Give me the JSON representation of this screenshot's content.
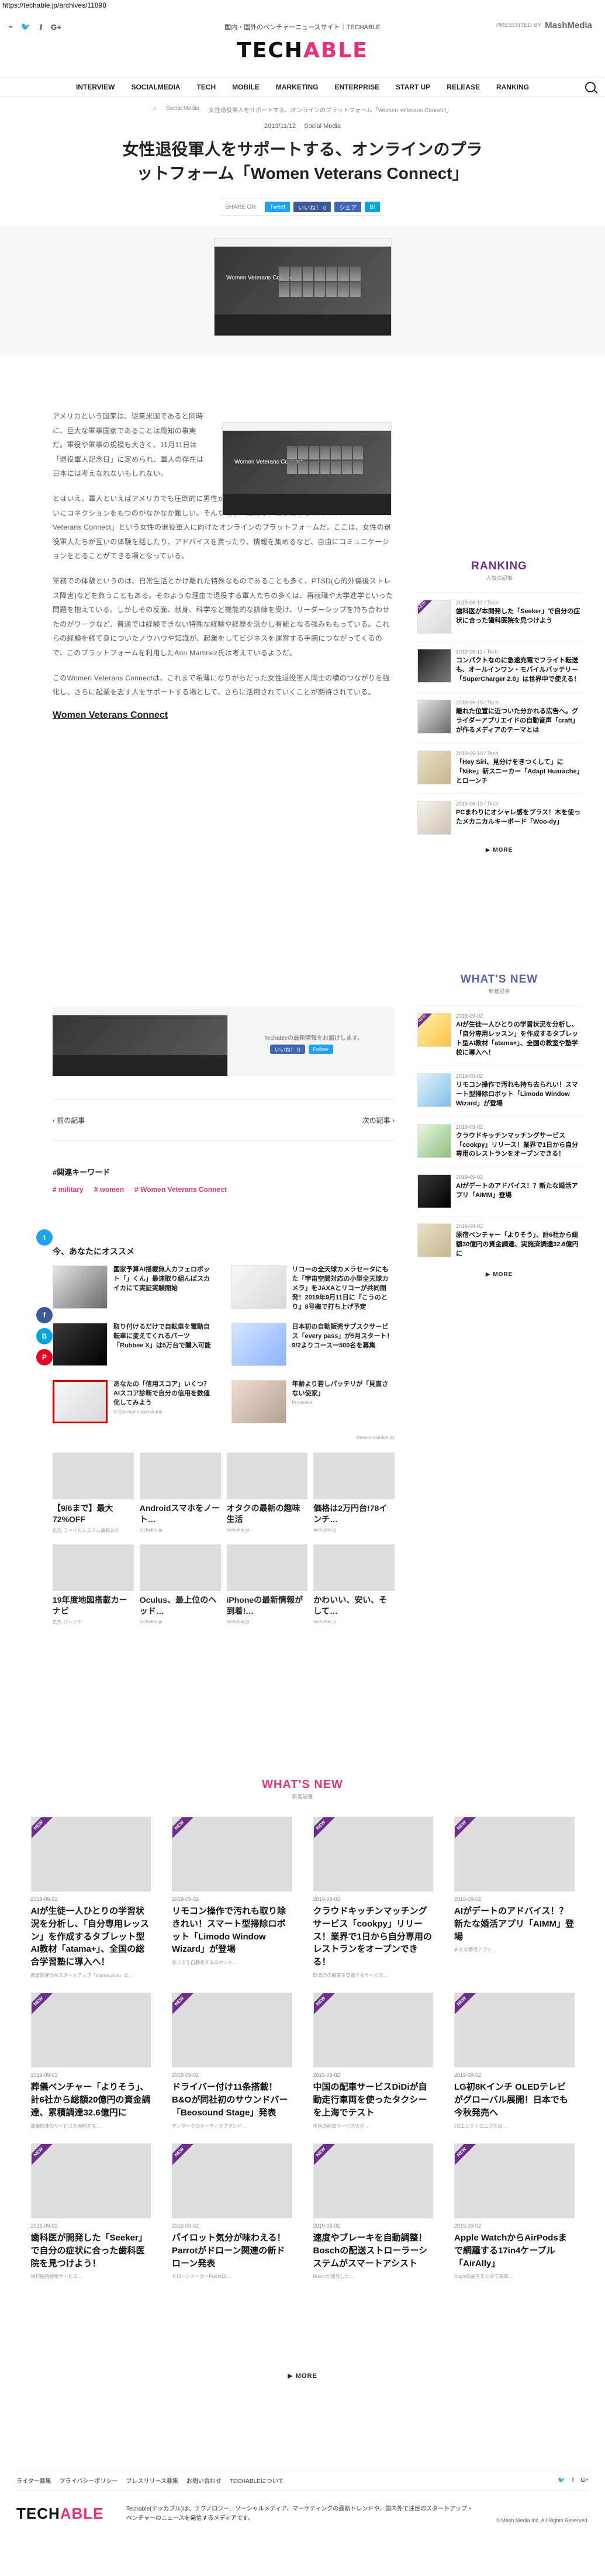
{
  "url": "https://techable.jp/archives/11898",
  "header": {
    "social_icons": [
      "rss-icon",
      "twitter-icon",
      "facebook-icon",
      "google-plus-icon"
    ],
    "tagline": "国内・国外のベンチャーニュースサイト｜TECHABLE",
    "presented": "PRESENTED BY",
    "presented_logo": "MashMedia",
    "logo_prefix": "TECH",
    "logo_suffix": "ABLE",
    "nav": [
      "INTERVIEW",
      "SOCIALMEDIA",
      "TECH",
      "MOBILE",
      "MARKETING",
      "ENTERPRISE",
      "START UP",
      "RELEASE",
      "RANKING"
    ]
  },
  "breadcrumb": [
    "⌂",
    "Social Media",
    "女性退役軍人をサポートする、オンラインのプラットフォーム「Women Veterans Connect」"
  ],
  "article": {
    "date": "2013/11/12",
    "category": "Social Media",
    "title": "女性退役軍人をサポートする、オンラインのプラットフォーム「Women Veterans Connect」",
    "share_label": "SHARE ON",
    "share_buttons": [
      "Tweet",
      "いいね！ 0",
      "シェア",
      "B!"
    ],
    "hero_caption": "Women Veterans Connect",
    "body_caption": "Women Veterans Connect",
    "paragraphs": [
      "アメリカという国家は、従来米国であると同時に、巨大な軍事国家であることは周知の事実だ。軍役や軍事の規模も大きく、11月11日は「退役軍人記念日」に定められ、軍人の存在は日本には考えなれないもしれない。",
      "とはいえ、軍人といえばアメリカでも圧倒的に男性が多く、マイノリティの存在である女性軍人は、お互いにコネクションをもつのがなかなか難しい。そんな現状に注目し、立ち上げられたのが、「Women Veterans Connect」という女性の退役軍人に向けたオンラインのプラットフォームだ。ここは、女性の退役軍人たちが互いの体験を話したり、アドバイスを貰ったり、情報を集めるなど、自由にコミュニケーションをとることができる場となっている。",
      "軍務での体験というのは、日常生活とかけ離れた特殊なものであることも多く、PTSD(心的外傷後ストレス障害)などを負うこともある。そのような理由で退役する軍人たちの多くは、再就職や大学進学といった問題を抱えている。しかしその反面、献身、科学など機能的な訓練を受け、リーダーシップを持ち合わせたのがワークなど、普通では経験できない特殊な経験や経歴を活かし有能となる強みももっている。これらの経験を経て身についたノウハウや知識が、起業をしてビジネスを運営する手腕につながってくるので、このプラットフォームを利用したAnn Martinez氏は考えているようだ。",
      "このWomen Veterans Connectは、これまで希薄になりがちだった女性退役軍人同士の横のつながりを強化し、さらに起業を志す人をサポートする場として、さらに活用されていくことが期待されている。"
    ],
    "source_link": "Women Veterans Connect",
    "follow_text": "Techableの最新情報をお届けします。",
    "follow_buttons": [
      "いいね！ 0",
      "Follow"
    ],
    "prev": "‹ 前の記事",
    "next": "次の記事 ›",
    "keyword_title": "#関連キーワード",
    "keywords": [
      "# military",
      "# women",
      "# Women Veterans Connect"
    ]
  },
  "sidebar": {
    "ranking_title": "RANKING",
    "ranking_sub": "人気の記事",
    "ranking": [
      {
        "meta": "2019-06-12 / Tech",
        "text": "歯科医が本開発した「Seeker」で自分の症状に合った歯科医院を見つけよう"
      },
      {
        "meta": "2019-06-11 / Tech",
        "text": "コンパクトなのに急速充電でフライト転送も、オールインワン・モバイルバッテリー「SuperCharger 2.0」は世界中で使える！"
      },
      {
        "meta": "2019-06-10 / Tech",
        "text": "離れた位置に近ついた分かれる広告へ。グライダーアプリエイドの自動音声「craft」が作るメディアのテーマとは"
      },
      {
        "meta": "2019-06-10 / Tech",
        "text": "「Hey Siri、見分けをきつくして」に「Nike」新スニーカー「Adapt Huarache」とローンチ"
      },
      {
        "meta": "2019-06-10 / Tech",
        "text": "PCまわりにオシャレ感をプラス！木を使ったメカニカルキーボード「Woo-dy」"
      }
    ],
    "ranking_more": "▶ MORE",
    "news_title": "WHAT'S NEW",
    "news_sub": "新着記事",
    "news": [
      {
        "meta": "2019-09-02",
        "text": "AIが生徒一人ひとりの学習状況を分析し、「自分専用レッスン」を作成するタブレット型AI教材「atama+」、全国の教室や塾学校に導入へ！"
      },
      {
        "meta": "2019-09-02",
        "text": "リモコン操作で汚れも持ち去られい！スマート型掃除ロボット「Limodo Window Wizard」が登場"
      },
      {
        "meta": "2019-09-02",
        "text": "クラウドキッチンマッチングサービス「cookpy」リリース！業界で1日から自分専用のレストランをオープンできる！"
      },
      {
        "meta": "2019-09-02",
        "text": "AIがデートのアドバイス！？新たな婚活アプリ「AIMM」登場"
      },
      {
        "meta": "2019-09-02",
        "text": "原宿ベンチャー「よりそう」、計6社から総額30億円の資金調達、実施済調達32.6億円に"
      }
    ],
    "news_more": "▶ MORE"
  },
  "recommend": {
    "title": "今、あなたにオススメ",
    "items": [
      {
        "text": "国家予算AI搭載無人カフェロボット「」くん」最速取り組んばスカイカにて実証実験開始",
        "source": ""
      },
      {
        "text": "リコーの全天球カメラセータにもた「宇宙空間対応の小型全天球カメラ」をJAXAとリコーが共同開発！2019年9月11日に『こうのとり』8号機で打ち上げ予定",
        "source": ""
      },
      {
        "text": "取り付けるだけで自転車を電動自転車に変えてくれるパーツ「Rubbee X」は5万台で購入可能",
        "source": ""
      },
      {
        "text": "日本初の自動販売サブスクサービス「every pass」が5月スタート！9/2よりコース一500名を募集",
        "source": ""
      },
      {
        "text": "あなたの「信用スコア」いくつ？AIスコア診断で自分の信用を数値化してみよう",
        "source": "© Sponsor:mizuhobank"
      },
      {
        "text": "年齢より若しパッテリが「見直さない使家」",
        "source": "Promoted"
      }
    ],
    "recommended_by": "Recommended by"
  },
  "ads": [
    {
      "title": "【9/6まで】最大72%OFF",
      "source": "広告 ファイルシステム情報あり"
    },
    {
      "title": "Androidスマホをノート…",
      "source": "techable.jp"
    },
    {
      "title": "オタクの最新の趣味生活",
      "source": "techable.jp"
    },
    {
      "title": "価格は2万円台!78インチ…",
      "source": "techable.jp"
    },
    {
      "title": "19年度地図搭載カーナビ",
      "source": "広告 パーソナ"
    },
    {
      "title": "Oculus、最上位のヘッド…",
      "source": "techable.jp"
    },
    {
      "title": "iPhoneの最新情報が到着!…",
      "source": "techable.jp"
    },
    {
      "title": "かわいい、安い、そして…",
      "source": "techable.jp"
    }
  ],
  "whats_new_grid": {
    "title": "WHAT'S NEW",
    "sub": "新着記事",
    "items": [
      {
        "meta": "2019-09-02",
        "title": "AIが生徒一人ひとりの学習状況を分析し、「自分専用レッスン」を作成するタブレット型AI教材「atama+」、全国の総合学習塾に導入へ！",
        "desc": "教育関連のAIスタートアップ「atama plus」は…"
      },
      {
        "meta": "2019-09-02",
        "title": "リモコン操作で汚れも取り除きれい！スマート型掃除ロボット「Limodo Window Wizard」が登場",
        "desc": "窓ふきを自動化するロボット…"
      },
      {
        "meta": "2019-09-02",
        "title": "クラウドキッチンマッチングサービス「cookpy」リリース！業界で1日から自分専用のレストランをオープンできる！",
        "desc": "飲食店の開業を支援するサービス…"
      },
      {
        "meta": "2019-09-02",
        "title": "AIがデートのアドバイス！？新たな婚活アプリ「AIMM」登場",
        "desc": "新たな婚活アプリ…"
      },
      {
        "meta": "2019-09-02",
        "title": "葬儀ベンチャー「よりそう」、計6社から総額20億円の資金調達、累積調達32.6億円に",
        "desc": "葬儀関連のサービスを展開する…"
      },
      {
        "meta": "2019-09-02",
        "title": "ドライバー付け11条搭載！B&Oが同社初のサウンドバー「Beosound Stage」発表",
        "desc": "デンマークのオーディオブランド…"
      },
      {
        "meta": "2019-09-02",
        "title": "中国の配車サービスDiDiが自動走行車両を使ったタクシーを上海でテスト",
        "desc": "中国の配車サービス大手…"
      },
      {
        "meta": "2019-09-02",
        "title": "LG初8Kインチ OLEDテレビがグローバル展開！日本でも今秋発売へ",
        "desc": "LGエレクトロニクスは…"
      },
      {
        "meta": "2019-09-02",
        "title": "歯科医が開発した「Seeker」で自分の症状に合った歯科医院を見つけよう！",
        "desc": "歯科医院検索サービス…"
      },
      {
        "meta": "2019-09-02",
        "title": "パイロット気分が味わえる！Parrotがドローン関連の新ドローン発表",
        "desc": "ドローンメーカーParrotは…"
      },
      {
        "meta": "2019-09-02",
        "title": "速度やブレーキを自動調整！Boschの配送ストローラーシステムがスマートアシスト",
        "desc": "Boschが開発した…"
      },
      {
        "meta": "2019-09-02",
        "title": "Apple WatchからAirPodsまで網羅する17in4ケーブル「AirAlly」",
        "desc": "Apple製品をまとめて充電…"
      }
    ],
    "more": "▶ MORE"
  },
  "footer": {
    "links": [
      "ライター募集",
      "プライバシーポリシー",
      "プレスリリース募集",
      "お問い合わせ",
      "TECHABLEについて"
    ],
    "social": [
      "twitter-icon",
      "facebook-icon",
      "google-plus-icon"
    ],
    "logo_prefix": "TECH",
    "logo_suffix": "ABLE",
    "description": "Techable(テッカブル)は、テクノロジー、ソーシャルメディア、マーケティングの最新トレンドや、国内外で注目のスタートアップ・ベンチャーのニュースを発信するメディアです。",
    "copyright": "© Mash Media Inc. All Rights Reserved."
  }
}
